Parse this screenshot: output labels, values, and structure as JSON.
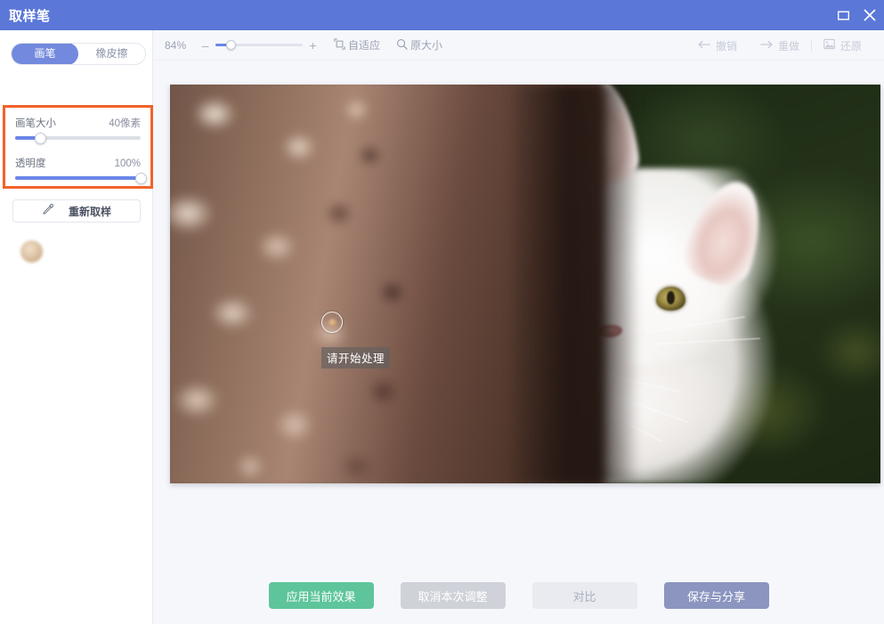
{
  "window": {
    "title": "取样笔",
    "maximize_icon": "maximize-icon",
    "close_icon": "close-icon"
  },
  "sidebar": {
    "tool_tabs": [
      {
        "label": "画笔",
        "active": true
      },
      {
        "label": "橡皮擦",
        "active": false
      }
    ],
    "sliders": [
      {
        "name": "brush-size",
        "label": "画笔大小",
        "value_text": "40像素",
        "value": 40,
        "percent": 20
      },
      {
        "name": "opacity",
        "label": "透明度",
        "value_text": "100%",
        "value": 100,
        "percent": 100
      }
    ],
    "highlight_color": "#f2622a",
    "resample": {
      "label": "重新取样",
      "icon": "eyedropper-icon"
    },
    "sampled_color": {
      "name": "sampled-color-swatch",
      "hex": "#d3b38c"
    }
  },
  "toolbar": {
    "zoom_percent_text": "84%",
    "zoom_percent": 84,
    "zoom_slider_percent": 18,
    "zoom_out_label": "–",
    "zoom_in_label": "+",
    "fit_label": "自适应",
    "fit_icon": "fit-to-screen-icon",
    "original_label": "原大小",
    "original_icon": "magnifier-icon",
    "undo_label": "撤销",
    "undo_icon": "arrow-left-icon",
    "redo_label": "重做",
    "redo_icon": "arrow-right-icon",
    "restore_label": "还原",
    "restore_icon": "image-restore-icon"
  },
  "canvas": {
    "tooltip_text": "请开始处理",
    "cursor": "brush-circle-cursor",
    "photo_alt": "白猫从树干后探出头 (white cat peeking behind tree trunk)"
  },
  "footer": {
    "buttons": [
      {
        "label": "应用当前效果",
        "style": "apply",
        "color": "#5ec59a"
      },
      {
        "label": "取消本次调整",
        "style": "cancel",
        "color": "#cfd2d9"
      },
      {
        "label": "对比",
        "style": "compare",
        "color": "#e9ebf0"
      },
      {
        "label": "保存与分享",
        "style": "save",
        "color": "#8b95bf"
      }
    ]
  }
}
